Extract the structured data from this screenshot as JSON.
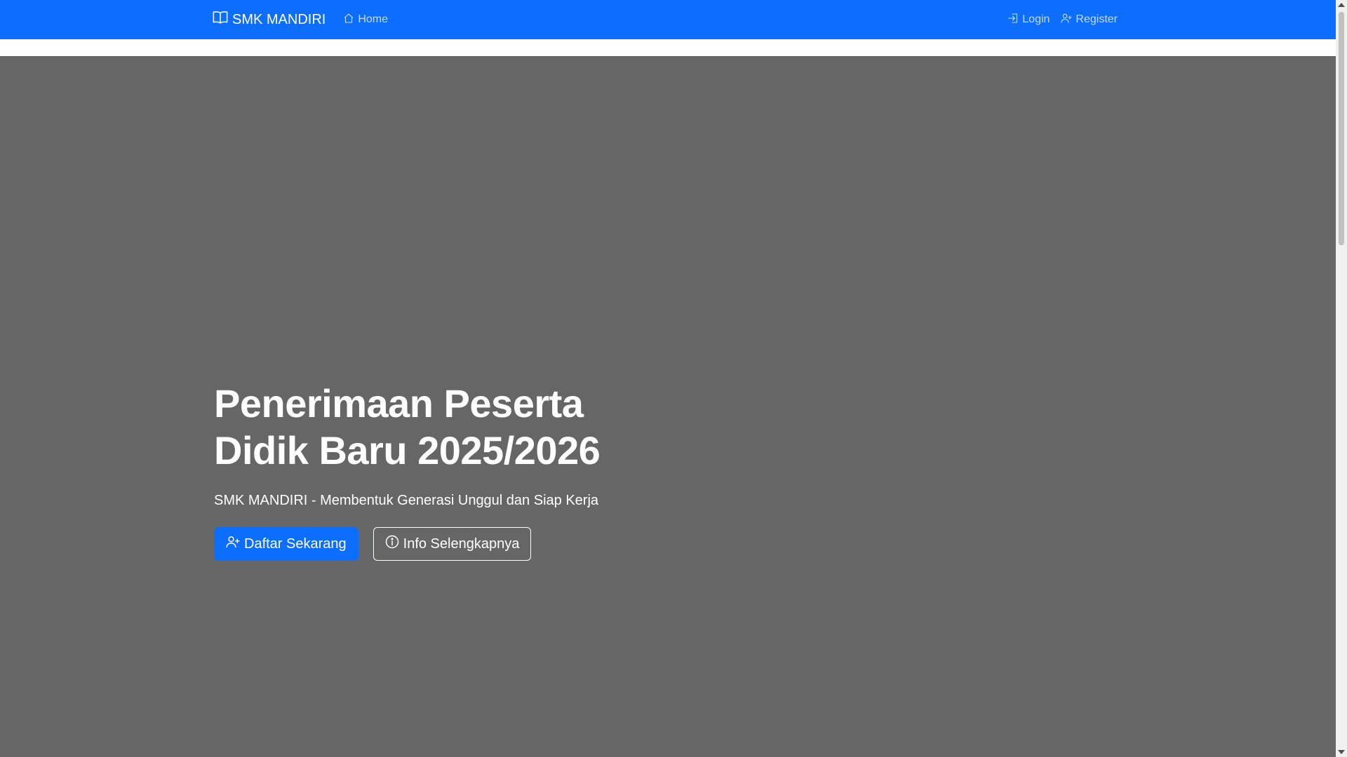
{
  "navbar": {
    "brand": "SMK MANDIRI",
    "brand_icon": "book-icon",
    "home": "Home",
    "home_icon": "house-icon",
    "login": "Login",
    "login_icon": "login-icon",
    "register": "Register",
    "register_icon": "person-plus-icon"
  },
  "hero": {
    "title_line1": "Penerimaan Peserta",
    "title_line2": "Didik Baru 2025/2026",
    "subtitle": "SMK MANDIRI - Membentuk Generasi Unggul dan Siap Kerja",
    "primary_button": "Daftar Sekarang",
    "primary_icon": "person-plus-icon",
    "secondary_button": "Info Selengkapnya",
    "secondary_icon": "info-circle-icon"
  },
  "colors": {
    "primary": "#0d6efd",
    "hero_bg": "#666666"
  }
}
